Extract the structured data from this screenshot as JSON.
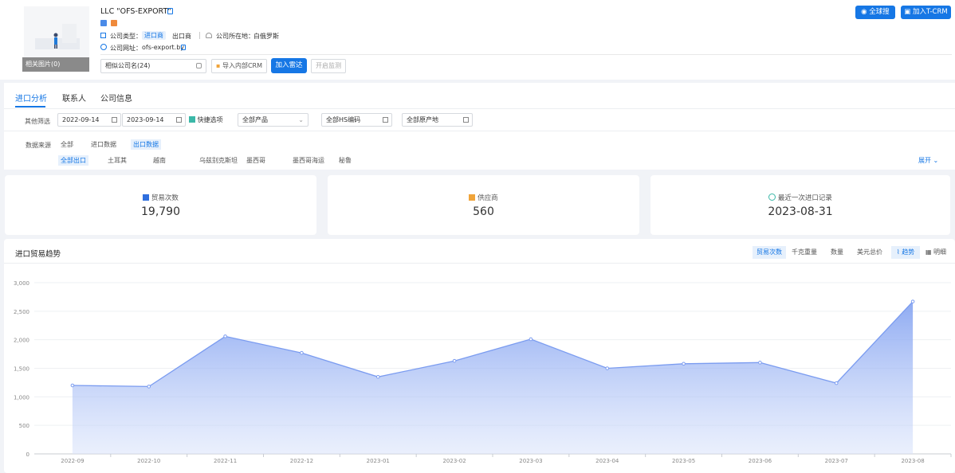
{
  "company": {
    "name": "LLC \"OFS-EXPORT\"",
    "type_label": "公司类型：",
    "type_importer": "进口商",
    "type_exporter": "出口商",
    "location_label": "公司所在地：",
    "location": "白俄罗斯",
    "website_label": "公司网址：",
    "website": "ofs-export.by",
    "photo_button": "相关图片(0)"
  },
  "header_buttons": {
    "global_search": "全球搜",
    "add_tcrm": "加入T-CRM"
  },
  "actions": {
    "similar_name": "相似公司名(24)",
    "import_crm": "导入内部CRM",
    "add_radar": "加入雷达",
    "start_monitor": "开启监测"
  },
  "tabs": [
    "进口分析",
    "联系人",
    "公司信息"
  ],
  "filters": {
    "label": "其他筛选",
    "date_from": "2022-09-14",
    "date_to": "2023-09-14",
    "quick_option": "快捷选项",
    "product": "全部产品",
    "hs_code": "全部HS编码",
    "origin": "全部原产地"
  },
  "sources": {
    "label": "数据来源",
    "items": [
      "全部",
      "进口数据",
      "出口数据"
    ],
    "active_index": 2
  },
  "export_countries": {
    "items": [
      "全部出口",
      "土耳其",
      "越南",
      "乌兹别克斯坦",
      "墨西哥",
      "墨西哥海运",
      "秘鲁"
    ],
    "active_index": 0,
    "expand": "展开"
  },
  "stats": [
    {
      "label": "贸易次数",
      "value": "19,790",
      "icon": "bar-chart-icon",
      "color": "#2f6fde"
    },
    {
      "label": "供应商",
      "value": "560",
      "icon": "supplier-icon",
      "color": "#f0a43a"
    },
    {
      "label": "最近一次进口记录",
      "value": "2023-08-31",
      "icon": "clock-icon",
      "color": "#3bb8a8"
    }
  ],
  "chart_panel": {
    "title": "进口贸易趋势",
    "metrics": [
      "贸易次数",
      "千克重量",
      "数量",
      "美元总价"
    ],
    "active_metric": 0,
    "views": [
      "趋势",
      "明细"
    ],
    "active_view": 0
  },
  "chart_data": {
    "type": "area",
    "categories": [
      "2022-09",
      "2022-10",
      "2022-11",
      "2022-12",
      "2023-01",
      "2023-02",
      "2023-03",
      "2023-04",
      "2023-05",
      "2023-06",
      "2023-07",
      "2023-08"
    ],
    "values": [
      1200,
      1180,
      2060,
      1770,
      1350,
      1630,
      2010,
      1500,
      1580,
      1600,
      1240,
      2670
    ],
    "ylim": [
      0,
      3000
    ],
    "yticks": [
      0,
      500,
      1000,
      1500,
      2000,
      2500,
      3000
    ],
    "ytick_labels": [
      "0",
      "500",
      "1,000",
      "1,500",
      "2,000",
      "2,500",
      "3,000"
    ],
    "grid": true,
    "color": "#7b9cf0"
  }
}
